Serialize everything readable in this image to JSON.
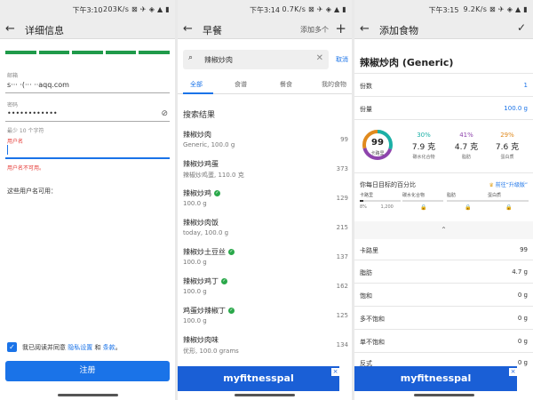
{
  "panel1": {
    "status": {
      "time": "下午3:10",
      "right": "203K/s ⊠ ✈ ◈ ▲ ▮"
    },
    "header": {
      "back": "←",
      "title": "详细信息"
    },
    "email": {
      "label": "邮箱",
      "value": "s··· ·(··· ··aqq.com"
    },
    "password": {
      "label": "密码",
      "value": "••••••••••••",
      "hint": "最少 10 个字符"
    },
    "username": {
      "label": "用户名",
      "error": "用户名不可用。"
    },
    "available": "这些用户名可用：",
    "consent": {
      "prefix": "我已阅读并同意",
      "privacy": "隐私设置",
      "and": "和",
      "terms": "条款",
      "suffix": "。"
    },
    "register_label": "注册"
  },
  "panel2": {
    "status": {
      "time": "下午3:14",
      "right": "0.7K/s ⊠ ✈ ◈ ▲ ▮"
    },
    "header": {
      "back": "←",
      "title": "早餐",
      "add_multiple": "添加多个",
      "plus": "+"
    },
    "search": {
      "value": "辣椒炒肉",
      "cancel": "取消"
    },
    "tabs": [
      "全部",
      "食谱",
      "餐食",
      "我的食物"
    ],
    "section_title": "搜索结果",
    "results": [
      {
        "name": "辣椒炒肉",
        "sub": "Generic, 100.0 g",
        "cal": "99",
        "verified": false
      },
      {
        "name": "辣椒炒鸡蛋",
        "sub": "辣椒炒鸡蛋, 110.0 克",
        "cal": "373",
        "verified": false
      },
      {
        "name": "辣椒炒鸡",
        "sub": "100.0 g",
        "cal": "129",
        "verified": true
      },
      {
        "name": "辣椒炒肉饭",
        "sub": "today, 100.0 g",
        "cal": "215",
        "verified": false
      },
      {
        "name": "辣椒炒土豆丝",
        "sub": "100.0 g",
        "cal": "137",
        "verified": true
      },
      {
        "name": "辣椒炒鸡丁",
        "sub": "100.0 g",
        "cal": "162",
        "verified": true
      },
      {
        "name": "鸡蛋炒辣椒丁",
        "sub": "100.0 g",
        "cal": "125",
        "verified": true
      },
      {
        "name": "辣椒炒肉味",
        "sub": "优形, 100.0 grams",
        "cal": "134",
        "verified": false
      }
    ],
    "ad": "myfitnesspal",
    "ad_close": "×"
  },
  "panel3": {
    "status": {
      "time": "下午3:15",
      "right": "9.2K/s ⊠ ✈ ◈ ▲ ▮"
    },
    "header": {
      "back": "←",
      "title": "添加食物",
      "check": "✓"
    },
    "food_title": "辣椒炒肉 (Generic)",
    "servings": {
      "label": "份数",
      "value": "1"
    },
    "amount": {
      "label": "份量",
      "value": "100.0 g"
    },
    "calories_ring": {
      "value": "99",
      "label": "卡路里"
    },
    "macros": [
      {
        "pct": "30%",
        "amount": "7.9 克",
        "label": "碳水化合物",
        "color": "#1bb0a6"
      },
      {
        "pct": "41%",
        "amount": "4.7 克",
        "label": "脂肪",
        "color": "#8e44ad"
      },
      {
        "pct": "29%",
        "amount": "7.6 克",
        "label": "蛋白质",
        "color": "#e08a1e"
      }
    ],
    "goal_heading": "你每日目标的百分比",
    "premium": "前往“升级版”",
    "goals": [
      {
        "label": "卡路里",
        "pct": "8%",
        "total": "1,200",
        "fill": 0.08,
        "locked": false
      },
      {
        "label": "碳水化合物",
        "locked": true,
        "lock": "🔒"
      },
      {
        "label": "脂肪",
        "locked": true,
        "lock": "🔒"
      },
      {
        "label": "蛋白质",
        "locked": true,
        "lock": "🔒"
      }
    ],
    "collapse": "⌃",
    "nutrients": [
      {
        "label": "卡路里",
        "value": "99"
      },
      {
        "label": "脂肪",
        "value": "4.7 g"
      },
      {
        "label": "饱和",
        "value": "0 g"
      },
      {
        "label": "多不饱和",
        "value": "0 g"
      },
      {
        "label": "单不饱和",
        "value": "0 g"
      },
      {
        "label": "反式",
        "value": "0 g"
      }
    ],
    "ad": "myfitnesspal",
    "ad_close": "×"
  },
  "colors": {
    "accent": "#1a73e8",
    "success": "#1f9a4a",
    "error": "#e53935",
    "ad": "#1a5fd6"
  }
}
